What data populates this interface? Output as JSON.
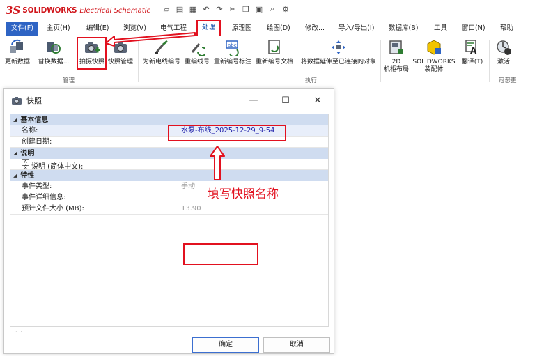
{
  "app": {
    "logo_mark": "3S",
    "logo_text": "SOLIDWORKS",
    "logo_sub": "Electrical Schematic"
  },
  "qat_icons": [
    "new-icon",
    "save-icon",
    "print-icon",
    "undo-icon",
    "redo-icon",
    "cut-icon",
    "copy-icon",
    "paste-icon",
    "search-icon",
    "settings-icon"
  ],
  "menu": {
    "items": [
      "文件(F)",
      "主页(H)",
      "编辑(E)",
      "浏览(V)",
      "电气工程",
      "处理",
      "原理图",
      "绘图(D)",
      "修改...",
      "导入/导出(I)",
      "数据库(B)",
      "工具",
      "窗口(N)",
      "帮助"
    ],
    "active_index": 5
  },
  "ribbon": {
    "buttons": [
      {
        "label": "更新数据",
        "icon": "update-data-icon"
      },
      {
        "label": "替换数据...",
        "icon": "replace-data-icon"
      },
      {
        "label": "拍摄快照",
        "icon": "take-snapshot-icon"
      },
      {
        "label": "快照管理",
        "icon": "snapshot-manager-icon"
      },
      {
        "label": "为新电线编号",
        "icon": "number-wires-icon"
      },
      {
        "label": "重编线号",
        "icon": "renumber-wires-icon"
      },
      {
        "label": "重新编号标注",
        "icon": "renumber-marks-icon"
      },
      {
        "label": "重新编号文档",
        "icon": "renumber-documents-icon"
      },
      {
        "label": "将数据延伸至已连接的对象",
        "icon": "propagate-data-icon"
      },
      {
        "label": "2D\n机柜布局",
        "icon": "cabinet-layout-icon"
      },
      {
        "label": "SOLIDWORKS\n装配体",
        "icon": "assembly-icon"
      },
      {
        "label": "翻译(T)",
        "icon": "translate-icon"
      },
      {
        "label": "激活",
        "icon": "activate-icon"
      }
    ],
    "groups": [
      "管理",
      "执行",
      "冠恶更"
    ]
  },
  "dialog": {
    "title": "快照",
    "controls": {
      "minimize": "—",
      "maximize": "☐",
      "close": "✕"
    },
    "sections": [
      {
        "title": "基本信息",
        "props": [
          {
            "key": "名称:",
            "value": "水泵-布线_2025-12-29_9-54"
          },
          {
            "key": "创建日期:",
            "value": ""
          }
        ]
      },
      {
        "title": "说明",
        "props": [
          {
            "key": "说明 (简体中文):",
            "value": ""
          }
        ]
      },
      {
        "title": "特性",
        "props": [
          {
            "key": "事件类型:",
            "value": "手动"
          },
          {
            "key": "事件详细信息:",
            "value": ""
          },
          {
            "key": "预计文件大小 (MB):",
            "value": "13.90"
          }
        ]
      }
    ],
    "annotation": "填写快照名称",
    "ok_label": "确定",
    "cancel_label": "取消"
  },
  "colors": {
    "accent": "#2e64c4",
    "highlight": "#e2111f",
    "category_bg": "#cfdcf0"
  }
}
